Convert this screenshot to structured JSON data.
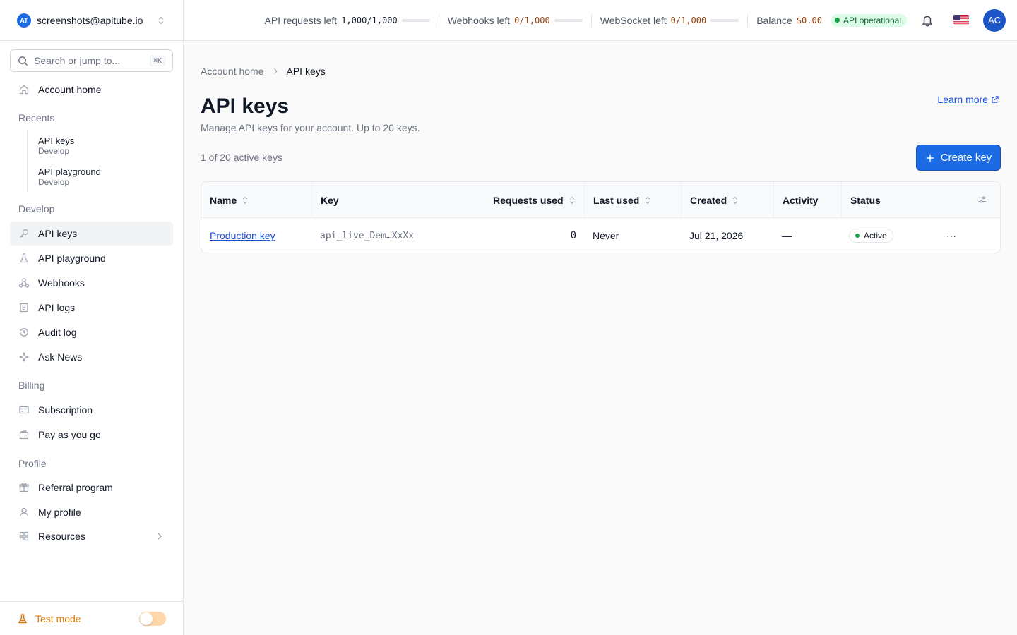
{
  "account": {
    "logo_text": "AT",
    "email": "screenshots@apitube.io"
  },
  "search": {
    "placeholder": "Search or jump to...",
    "shortcut": "⌘K"
  },
  "nav": {
    "home": "Account home",
    "recents_label": "Recents",
    "recents": [
      {
        "title": "API keys",
        "sub": "Develop"
      },
      {
        "title": "API playground",
        "sub": "Develop"
      }
    ],
    "develop_label": "Develop",
    "develop": [
      "API keys",
      "API playground",
      "Webhooks",
      "API logs",
      "Audit log",
      "Ask News"
    ],
    "billing_label": "Billing",
    "billing": [
      "Subscription",
      "Pay as you go"
    ],
    "profile_label": "Profile",
    "profile": [
      "Referral program",
      "My profile",
      "Resources"
    ]
  },
  "test_mode": {
    "label": "Test mode",
    "enabled": false
  },
  "topbar": {
    "requests_label": "API requests left",
    "requests_value": "1,000/1,000",
    "webhooks_label": "Webhooks left",
    "webhooks_value": "0/1,000",
    "websocket_label": "WebSocket left",
    "websocket_value": "0/1,000",
    "balance_label": "Balance",
    "balance_value": "$0.00",
    "status": "API operational",
    "avatar_initials": "AC"
  },
  "breadcrumb": {
    "parent": "Account home",
    "current": "API keys"
  },
  "page": {
    "title": "API keys",
    "subtitle": "Manage API keys for your account. Up to 20 keys.",
    "learn_more": "Learn more",
    "count": "1 of 20 active keys",
    "create_button": "Create key"
  },
  "table": {
    "columns": [
      "Name",
      "Key",
      "Requests used",
      "Last used",
      "Created",
      "Activity",
      "Status"
    ],
    "rows": [
      {
        "name": "Production key",
        "key": "api_live_Dem…XxXx",
        "requests": "0",
        "last_used": "Never",
        "created": "Jul 21, 2026",
        "activity": "—",
        "status": "Active"
      }
    ],
    "more_label": "···"
  },
  "colors": {
    "accent": "#1d6ae5",
    "status_ok": "#16a34a",
    "test_mode": "#d97706"
  }
}
